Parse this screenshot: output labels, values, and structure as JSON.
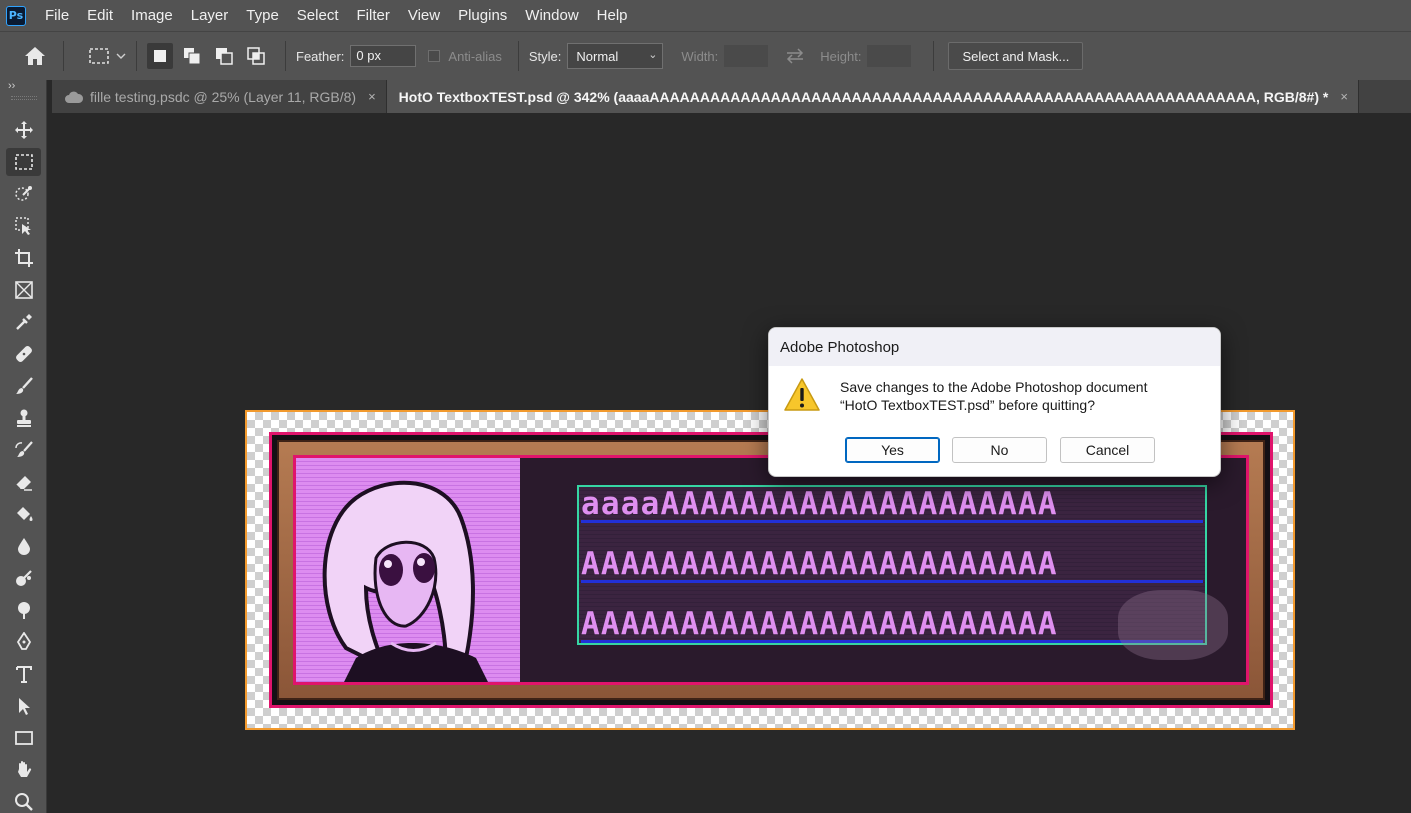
{
  "app": {
    "logo_text": "Ps"
  },
  "menu": [
    "File",
    "Edit",
    "Image",
    "Layer",
    "Type",
    "Select",
    "Filter",
    "View",
    "Plugins",
    "Window",
    "Help"
  ],
  "options": {
    "feather_label": "Feather:",
    "feather_value": "0 px",
    "antialias_label": "Anti-alias",
    "style_label": "Style:",
    "style_value": "Normal",
    "width_label": "Width:",
    "height_label": "Height:",
    "select_mask_label": "Select and Mask..."
  },
  "tabs": [
    {
      "label": "fille testing.psdc @ 25% (Layer 11, RGB/8)",
      "close": "×",
      "cloud": true,
      "active": false
    },
    {
      "label": "HotO TextboxTEST.psd @ 342% (aaaaAAAAAAAAAAAAAAAAAAAAAAAAAAAAAAAAAAAAAAAAAAAAAAAAAAAAAAAAAAAA, RGB/8#) *",
      "close": "×",
      "active": true
    }
  ],
  "toolbar": {
    "collapse": "››"
  },
  "tools": [
    "move-icon",
    "rectangular-marquee-icon",
    "object-selection-icon",
    "crop-expand-icon",
    "crop-icon",
    "frame-icon",
    "eyedropper-icon",
    "healing-brush-icon",
    "brush-icon",
    "clone-stamp-icon",
    "history-brush-icon",
    "eraser-icon",
    "paint-bucket-icon",
    "blur-icon",
    "smudge-icon",
    "dodge-icon",
    "pen-icon",
    "type-icon",
    "path-selection-icon",
    "rectangle-icon",
    "hand-icon",
    "zoom-icon"
  ],
  "canvas_text": {
    "line1": "aaaaAAAAAAAAAAAAAAAAAAAA",
    "line2": "AAAAAAAAAAAAAAAAAAAAAAAA",
    "line3": "AAAAAAAAAAAAAAAAAAAAAAAA"
  },
  "dialog": {
    "title": "Adobe Photoshop",
    "message_line1": "Save changes to the Adobe Photoshop document",
    "message_line2": "“HotO TextboxTEST.psd” before quitting?",
    "yes": "Yes",
    "no": "No",
    "cancel": "Cancel"
  },
  "colors": {
    "ui_bg": "#535353",
    "workspace": "#282828",
    "doc_border": "#f29a2e",
    "frame_magenta": "#e0146c",
    "text_bounds": "#36d6a4",
    "text_baseline": "#2230d8",
    "portrait_pink": "#dd8cf0",
    "dialog_accent": "#0067c0"
  }
}
